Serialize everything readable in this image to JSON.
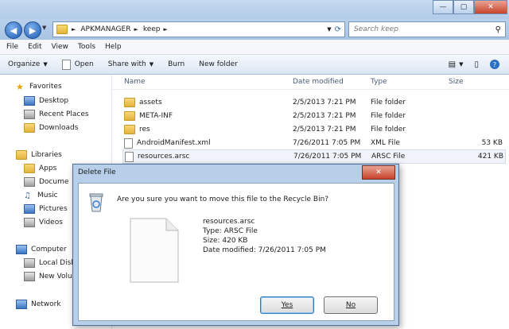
{
  "address": {
    "segments": [
      "APKMANAGER",
      "keep"
    ]
  },
  "search": {
    "placeholder": "Search keep"
  },
  "menu": [
    "File",
    "Edit",
    "View",
    "Tools",
    "Help"
  ],
  "toolbar": {
    "organize": "Organize",
    "open": "Open",
    "share": "Share with",
    "burn": "Burn",
    "new_folder": "New folder"
  },
  "sidebar": {
    "favorites": "Favorites",
    "fav_items": [
      "Desktop",
      "Recent Places",
      "Downloads"
    ],
    "libraries": "Libraries",
    "lib_items": [
      "Apps",
      "Docume",
      "Music",
      "Pictures",
      "Videos"
    ],
    "computer": "Computer",
    "comp_items": [
      "Local Disk",
      "New Volu"
    ],
    "network": "Network"
  },
  "columns": {
    "name": "Name",
    "date": "Date modified",
    "type": "Type",
    "size": "Size"
  },
  "files": [
    {
      "name": "assets",
      "date": "2/5/2013 7:21 PM",
      "type": "File folder",
      "size": ""
    },
    {
      "name": "META-INF",
      "date": "2/5/2013 7:21 PM",
      "type": "File folder",
      "size": ""
    },
    {
      "name": "res",
      "date": "2/5/2013 7:21 PM",
      "type": "File folder",
      "size": ""
    },
    {
      "name": "AndroidManifest.xml",
      "date": "7/26/2011 7:05 PM",
      "type": "XML File",
      "size": "53 KB"
    },
    {
      "name": "resources.arsc",
      "date": "7/26/2011 7:05 PM",
      "type": "ARSC File",
      "size": "421 KB"
    }
  ],
  "dialog": {
    "title": "Delete File",
    "question": "Are you sure you want to move this file to the Recycle Bin?",
    "file_name": "resources.arsc",
    "file_type": "Type: ARSC File",
    "file_size": "Size: 420 KB",
    "file_date": "Date modified: 7/26/2011 7:05 PM",
    "yes": "Yes",
    "no": "No"
  }
}
